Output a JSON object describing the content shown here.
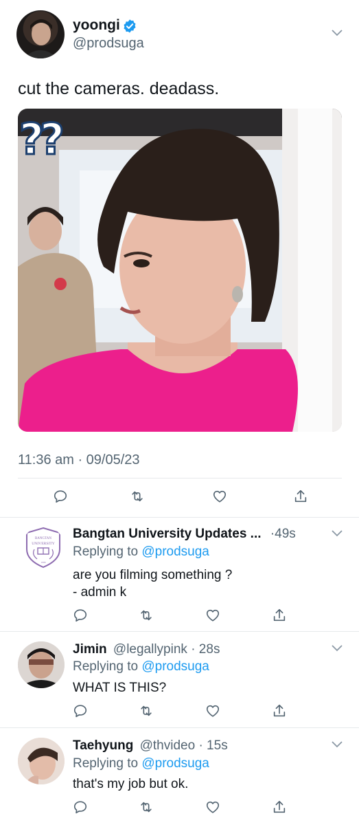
{
  "tweet": {
    "name": "yoongi",
    "handle": "@prodsuga",
    "text": "cut the cameras. deadass.",
    "image_overlay_text": "??",
    "timestamp": "11:36 am · 09/05/23"
  },
  "replies": [
    {
      "name": "Bangtan University Updates ...",
      "handle": "",
      "time": "·49s",
      "replying_prefix": "Replying to",
      "replying_to": "@prodsuga",
      "text": [
        "are you filming something ?",
        "- admin k"
      ],
      "avatar_label": "BANGTAN UNIVERSITY"
    },
    {
      "name": "Jimin",
      "handle": "@legallypink",
      "time": "· 28s",
      "replying_prefix": "Replying to",
      "replying_to": "@prodsuga",
      "text": [
        "WHAT IS THIS?"
      ]
    },
    {
      "name": "Taehyung",
      "handle": "@thvideo",
      "time": "· 15s",
      "replying_prefix": "Replying to",
      "replying_to": "@prodsuga",
      "text": [
        "that's my job but ok."
      ]
    }
  ],
  "icons": [
    "chevron-down-icon",
    "verified-badge-icon",
    "reply-icon",
    "retweet-icon",
    "like-icon",
    "share-icon"
  ],
  "colors": {
    "accent": "#1d9bf0",
    "text": "#0f1419",
    "secondary": "#536471",
    "divider": "#e6e9eb",
    "shirt": "#ec1f8c"
  }
}
